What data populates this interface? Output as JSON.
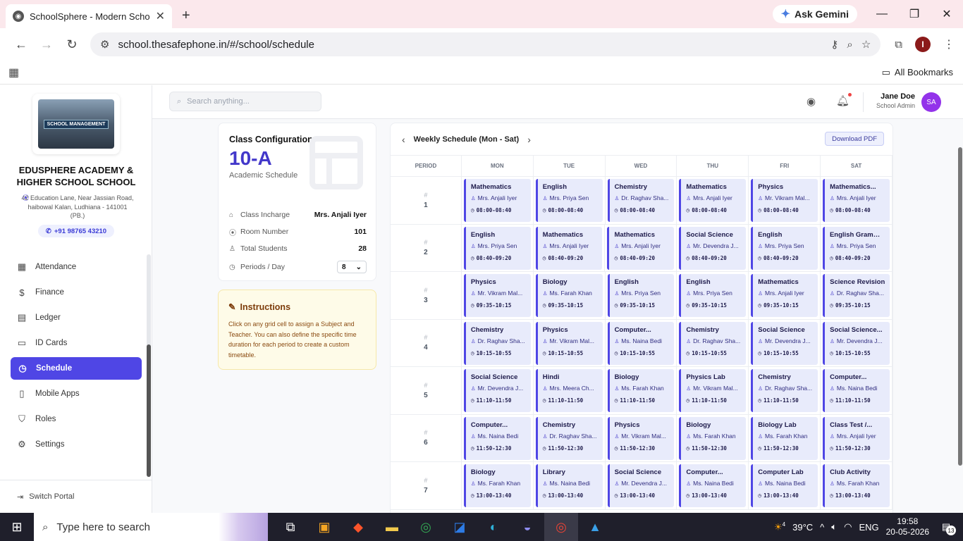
{
  "browser": {
    "tab_title": "SchoolSphere - Modern School",
    "url": "school.thesafephone.in/#/school/schedule",
    "gemini_label": "Ask Gemini",
    "profile_initial": "I",
    "all_bookmarks": "All Bookmarks"
  },
  "school": {
    "logo_text": "SCHOOL MANAGEMENT",
    "name": "EDUSPHERE ACADEMY & HIGHER SCHOOL SCHOOL",
    "address": "42 Education Lane, Near Jassian Road, haibowal Kalan, Ludhiana - 141001 (PB.)",
    "phone": "+91 98765 43210"
  },
  "sidebar": {
    "items": [
      {
        "label": "Attendance",
        "icon": "calendar-check-icon",
        "glyph": "▦",
        "active": false
      },
      {
        "label": "Finance",
        "icon": "dollar-icon",
        "glyph": "$",
        "active": false
      },
      {
        "label": "Ledger",
        "icon": "ledger-icon",
        "glyph": "▤",
        "active": false
      },
      {
        "label": "ID Cards",
        "icon": "id-card-icon",
        "glyph": "▭",
        "active": false
      },
      {
        "label": "Schedule",
        "icon": "clock-icon",
        "glyph": "◷",
        "active": true
      },
      {
        "label": "Mobile Apps",
        "icon": "mobile-icon",
        "glyph": "▯",
        "active": false
      },
      {
        "label": "Roles",
        "icon": "shield-icon",
        "glyph": "⛉",
        "active": false
      },
      {
        "label": "Settings",
        "icon": "gear-icon",
        "glyph": "⚙",
        "active": false
      }
    ],
    "switch_portal": "Switch Portal"
  },
  "topbar": {
    "search_placeholder": "Search anything...",
    "user_name": "Jane Doe",
    "user_role": "School Admin",
    "avatar_initials": "SA"
  },
  "config": {
    "title": "Class Configuration",
    "class_name": "10-A",
    "subtitle": "Academic Schedule",
    "incharge_label": "Class Incharge",
    "incharge_value": "Mrs. Anjali Iyer",
    "room_label": "Room Number",
    "room_value": "101",
    "students_label": "Total Students",
    "students_value": "28",
    "periods_label": "Periods / Day",
    "periods_value": "8"
  },
  "instructions": {
    "title": "Instructions",
    "text": "Click on any grid cell to assign a Subject and Teacher. You can also define the specific time duration for each period to create a custom timetable."
  },
  "schedule": {
    "title": "Weekly Schedule (Mon - Sat)",
    "download_label": "Download PDF",
    "period_header": "PERIOD",
    "days": [
      "MON",
      "TUE",
      "WED",
      "THU",
      "FRI",
      "SAT"
    ],
    "hash": "#",
    "rows": [
      {
        "period": "1",
        "time": "08:00-08:40",
        "cells": [
          {
            "subject": "Mathematics",
            "teacher": "Mrs. Anjali Iyer"
          },
          {
            "subject": "English",
            "teacher": "Mrs. Priya Sen"
          },
          {
            "subject": "Chemistry",
            "teacher": "Dr. Raghav Sha..."
          },
          {
            "subject": "Mathematics",
            "teacher": "Mrs. Anjali Iyer"
          },
          {
            "subject": "Physics",
            "teacher": "Mr. Vikram Mal..."
          },
          {
            "subject": "Mathematics...",
            "teacher": "Mrs. Anjali Iyer"
          }
        ]
      },
      {
        "period": "2",
        "time": "08:40-09:20",
        "cells": [
          {
            "subject": "English",
            "teacher": "Mrs. Priya Sen"
          },
          {
            "subject": "Mathematics",
            "teacher": "Mrs. Anjali Iyer"
          },
          {
            "subject": "Mathematics",
            "teacher": "Mrs. Anjali Iyer"
          },
          {
            "subject": "Social Science",
            "teacher": "Mr. Devendra J..."
          },
          {
            "subject": "English",
            "teacher": "Mrs. Priya Sen"
          },
          {
            "subject": "English Grammar",
            "teacher": "Mrs. Priya Sen"
          }
        ]
      },
      {
        "period": "3",
        "time": "09:35-10:15",
        "cells": [
          {
            "subject": "Physics",
            "teacher": "Mr. Vikram Mal..."
          },
          {
            "subject": "Biology",
            "teacher": "Ms. Farah Khan"
          },
          {
            "subject": "English",
            "teacher": "Mrs. Priya Sen"
          },
          {
            "subject": "English",
            "teacher": "Mrs. Priya Sen"
          },
          {
            "subject": "Mathematics",
            "teacher": "Mrs. Anjali Iyer"
          },
          {
            "subject": "Science Revision",
            "teacher": "Dr. Raghav Sha..."
          }
        ]
      },
      {
        "period": "4",
        "time": "10:15-10:55",
        "cells": [
          {
            "subject": "Chemistry",
            "teacher": "Dr. Raghav Sha..."
          },
          {
            "subject": "Physics",
            "teacher": "Mr. Vikram Mal..."
          },
          {
            "subject": "Computer...",
            "teacher": "Ms. Naina Bedi"
          },
          {
            "subject": "Chemistry",
            "teacher": "Dr. Raghav Sha..."
          },
          {
            "subject": "Social Science",
            "teacher": "Mr. Devendra J..."
          },
          {
            "subject": "Social Science...",
            "teacher": "Mr. Devendra J..."
          }
        ]
      },
      {
        "period": "5",
        "time": "11:10-11:50",
        "cells": [
          {
            "subject": "Social Science",
            "teacher": "Mr. Devendra J..."
          },
          {
            "subject": "Hindi",
            "teacher": "Mrs. Meera Ch..."
          },
          {
            "subject": "Biology",
            "teacher": "Ms. Farah Khan"
          },
          {
            "subject": "Physics Lab",
            "teacher": "Mr. Vikram Mal..."
          },
          {
            "subject": "Chemistry",
            "teacher": "Dr. Raghav Sha..."
          },
          {
            "subject": "Computer...",
            "teacher": "Ms. Naina Bedi"
          }
        ]
      },
      {
        "period": "6",
        "time": "11:50-12:30",
        "cells": [
          {
            "subject": "Computer...",
            "teacher": "Ms. Naina Bedi"
          },
          {
            "subject": "Chemistry",
            "teacher": "Dr. Raghav Sha..."
          },
          {
            "subject": "Physics",
            "teacher": "Mr. Vikram Mal..."
          },
          {
            "subject": "Biology",
            "teacher": "Ms. Farah Khan"
          },
          {
            "subject": "Biology Lab",
            "teacher": "Ms. Farah Khan"
          },
          {
            "subject": "Class Test /...",
            "teacher": "Mrs. Anjali Iyer"
          }
        ]
      },
      {
        "period": "7",
        "time": "13:00-13:40",
        "cells": [
          {
            "subject": "Biology",
            "teacher": "Ms. Farah Khan"
          },
          {
            "subject": "Library",
            "teacher": "Ms. Naina Bedi"
          },
          {
            "subject": "Social Science",
            "teacher": "Mr. Devendra J..."
          },
          {
            "subject": "Computer...",
            "teacher": "Ms. Naina Bedi"
          },
          {
            "subject": "Computer Lab",
            "teacher": "Ms. Naina Bedi"
          },
          {
            "subject": "Club Activity",
            "teacher": "Ms. Farah Khan"
          }
        ]
      }
    ]
  },
  "taskbar": {
    "search_placeholder": "Type here to search",
    "weather": "39°C",
    "weather_badge": "4",
    "language": "ENG",
    "time": "19:58",
    "date": "20-05-2026",
    "notifications": "13"
  }
}
